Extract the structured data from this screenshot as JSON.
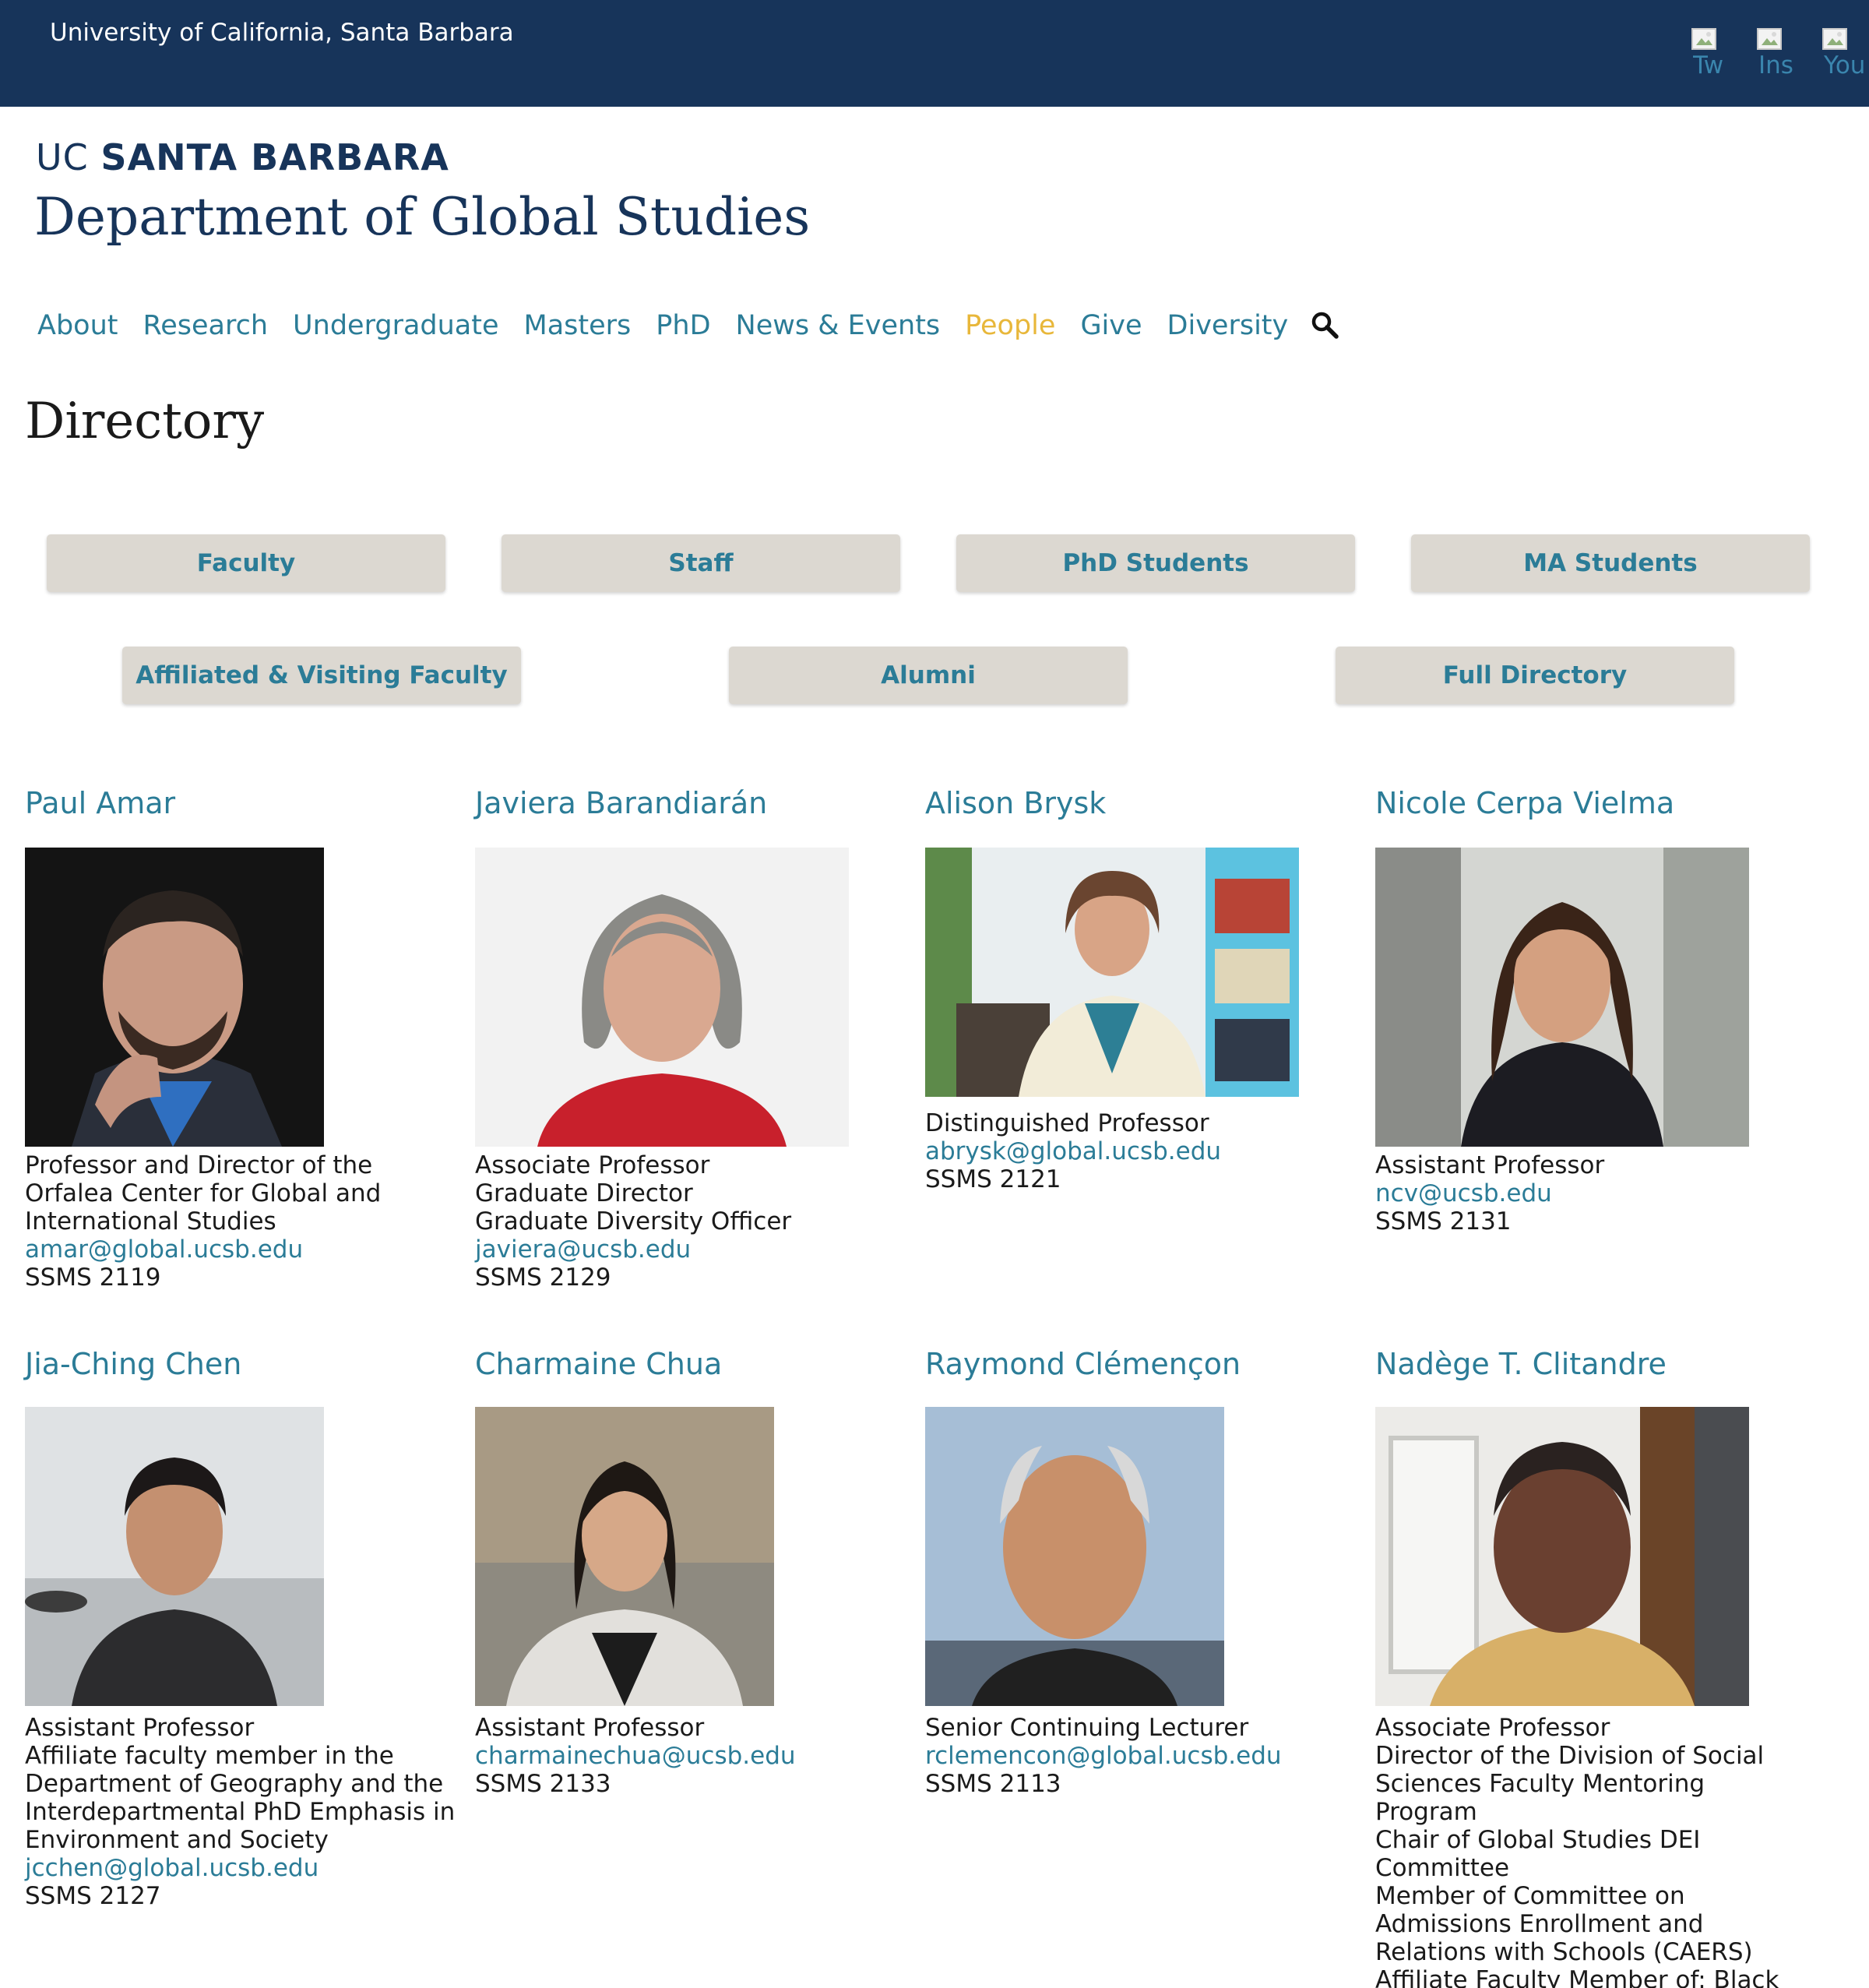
{
  "topbar": {
    "university": "University of California, Santa Barbara",
    "social": [
      {
        "alt": "Tw",
        "icon": "twitter-icon"
      },
      {
        "alt": "Ins",
        "icon": "instagram-icon"
      },
      {
        "alt": "You",
        "icon": "youtube-icon"
      }
    ]
  },
  "brand": {
    "uc": "UC",
    "santa_barbara": "SANTA BARBARA",
    "department": "Department of Global Studies"
  },
  "nav": {
    "items": [
      "About",
      "Research",
      "Undergraduate",
      "Masters",
      "PhD",
      "News & Events",
      "People",
      "Give",
      "Diversity"
    ],
    "active": "People",
    "search_icon": "search-icon"
  },
  "page": {
    "title": "Directory"
  },
  "filters": {
    "row1": [
      "Faculty",
      "Staff",
      "PhD Students",
      "MA Students"
    ],
    "row2": [
      "Affiliated & Visiting Faculty",
      "Alumni",
      "Full Directory"
    ]
  },
  "people": [
    {
      "name": "Paul Amar",
      "lines": [
        "Professor and Director of the",
        "Orfalea Center for Global and",
        "International Studies"
      ],
      "email": "amar@global.ucsb.edu",
      "office": "SSMS 2119"
    },
    {
      "name": "Javiera Barandiarán",
      "lines": [
        "Associate Professor",
        "Graduate Director",
        "Graduate Diversity Officer"
      ],
      "email": "javiera@ucsb.edu",
      "office": "SSMS 2129"
    },
    {
      "name": "Alison Brysk",
      "lines": [
        "Distinguished Professor"
      ],
      "email": "abrysk@global.ucsb.edu",
      "office": "SSMS 2121"
    },
    {
      "name": "Nicole Cerpa Vielma",
      "lines": [
        "Assistant Professor"
      ],
      "email": "ncv@ucsb.edu",
      "office": "SSMS 2131"
    },
    {
      "name": "Jia-Ching Chen",
      "lines": [
        "Assistant Professor",
        "Affiliate faculty member in the",
        "Department of Geography and the",
        "Interdepartmental PhD Emphasis in",
        "Environment and Society"
      ],
      "email": "jcchen@global.ucsb.edu",
      "office": "SSMS 2127"
    },
    {
      "name": "Charmaine Chua",
      "lines": [
        "Assistant Professor"
      ],
      "email": "charmainechua@ucsb.edu",
      "office": "SSMS 2133"
    },
    {
      "name": "Raymond Clémençon",
      "lines": [
        "Senior Continuing Lecturer"
      ],
      "email": "rclemencon@global.ucsb.edu",
      "office": "SSMS 2113"
    },
    {
      "name": "Nadège T. Clitandre",
      "lines": [
        "Associate Professor",
        "Director of the Division of Social",
        "Sciences Faculty Mentoring",
        "Program",
        "Chair of Global Studies DEI",
        "Committee",
        "Member of Committee on",
        "Admissions Enrollment and",
        "Relations with Schools (CAERS)",
        "Affiliate Faculty Member of: Black"
      ],
      "email": "",
      "office": ""
    }
  ],
  "colors": {
    "topbar_bg": "#17345a",
    "brand": "#17345a",
    "link": "#2b7c97",
    "nav_active": "#e8b73a",
    "button_bg": "#dcd8d1"
  }
}
